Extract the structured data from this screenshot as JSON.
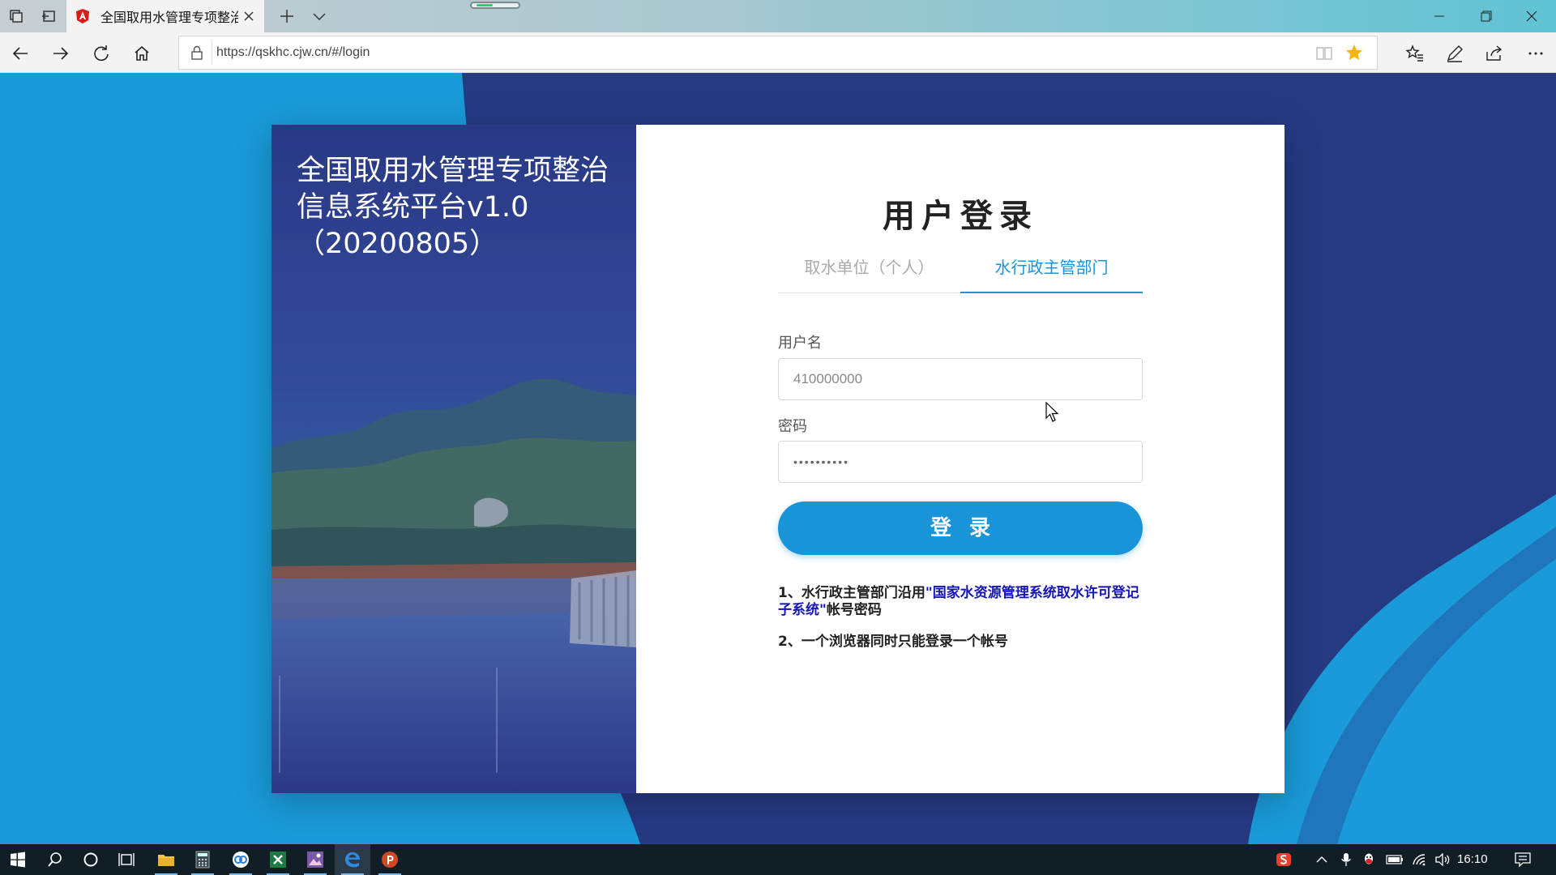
{
  "browser": {
    "tab_title": "全国取用水管理专项整治信息系统平台",
    "url": "https://qskhc.cjw.cn/#/login",
    "favorite_active": true,
    "accent_color": "#f6b400"
  },
  "hero": {
    "headline": "全国取用水管理专项整治信息系统平台v1.0（20200805）"
  },
  "login": {
    "title": "用户登录",
    "tabs": [
      {
        "label": "取水单位（个人）",
        "active": false
      },
      {
        "label": "水行政主管部门",
        "active": true
      }
    ],
    "username_label": "用户名",
    "username_value": "410000000",
    "password_label": "密码",
    "password_value": "••••••••••",
    "submit_label": "登录",
    "notes": {
      "n1_prefix": "1、水行政主管部门沿用",
      "n1_highlight": "\"国家水资源管理系统取水许可登记子系统\"",
      "n1_suffix": "帐号密码",
      "n2": "2、一个浏览器同时只能登录一个帐号"
    }
  },
  "colors": {
    "primary": "#1a94d8",
    "background": "#1a9ad8",
    "background_dark": "#263a82",
    "note_highlight": "#1515b8"
  },
  "taskbar": {
    "apps": [
      "start-icon",
      "search-icon",
      "cortana-icon",
      "task-view-icon",
      "file-explorer-icon",
      "calculator-icon",
      "app-icon",
      "excel-icon",
      "photos-icon",
      "edge-icon",
      "powerpoint-icon"
    ],
    "time": "16:10"
  }
}
